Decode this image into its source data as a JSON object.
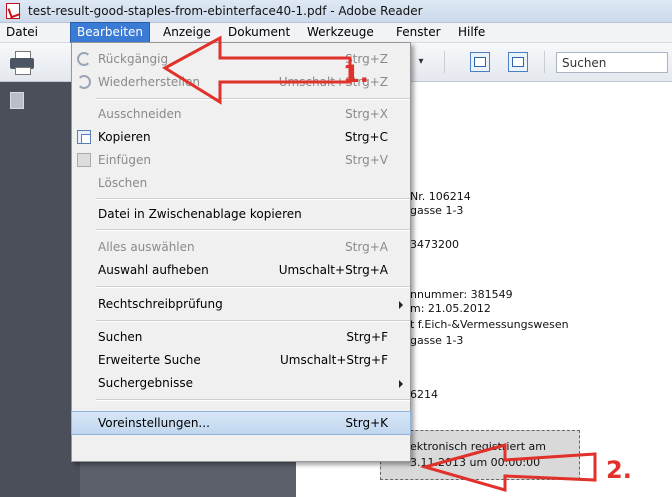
{
  "window": {
    "title": "test-result-good-staples-from-ebinterface40-1.pdf - Adobe Reader"
  },
  "menubar": {
    "items": [
      {
        "label": "Datei"
      },
      {
        "label": "Bearbeiten"
      },
      {
        "label": "Anzeige"
      },
      {
        "label": "Dokument"
      },
      {
        "label": "Werkzeuge"
      },
      {
        "label": "Fenster"
      },
      {
        "label": "Hilfe"
      }
    ]
  },
  "toolbar": {
    "search_placeholder": "Suchen"
  },
  "edit_menu": {
    "items": [
      {
        "label": "Rückgängig",
        "shortcut": "Strg+Z"
      },
      {
        "label": "Wiederherstellen",
        "shortcut": "Umschalt+Strg+Z"
      },
      {
        "label": "Ausschneiden",
        "shortcut": "Strg+X"
      },
      {
        "label": "Kopieren",
        "shortcut": "Strg+C"
      },
      {
        "label": "Einfügen",
        "shortcut": "Strg+V"
      },
      {
        "label": "Löschen",
        "shortcut": ""
      },
      {
        "label": "Datei in Zwischenablage kopieren",
        "shortcut": ""
      },
      {
        "label": "Alles auswählen",
        "shortcut": "Strg+A"
      },
      {
        "label": "Auswahl aufheben",
        "shortcut": "Umschalt+Strg+A"
      },
      {
        "label": "Rechtschreibprüfung",
        "shortcut": ""
      },
      {
        "label": "Suchen",
        "shortcut": "Strg+F"
      },
      {
        "label": "Erweiterte Suche",
        "shortcut": "Umschalt+Strg+F"
      },
      {
        "label": "Suchergebnisse",
        "shortcut": ""
      },
      {
        "label": "Voreinstellungen...",
        "shortcut": "Strg+K"
      }
    ]
  },
  "document": {
    "lines": [
      "Nr. 106214",
      "gasse 1-3",
      "3473200",
      "nnummer: 381549",
      "m: 21.05.2012",
      "t f.Eich-&Vermessungswesen",
      "gasse 1-3",
      "6214",
      "ektronisch registriert am",
      "3.11.2013 um 00:00:00"
    ]
  },
  "annotations": {
    "step1": "1.",
    "step2": "2."
  },
  "colors": {
    "menu_active": "#3a7bd5",
    "annotation": "#e0312b"
  }
}
